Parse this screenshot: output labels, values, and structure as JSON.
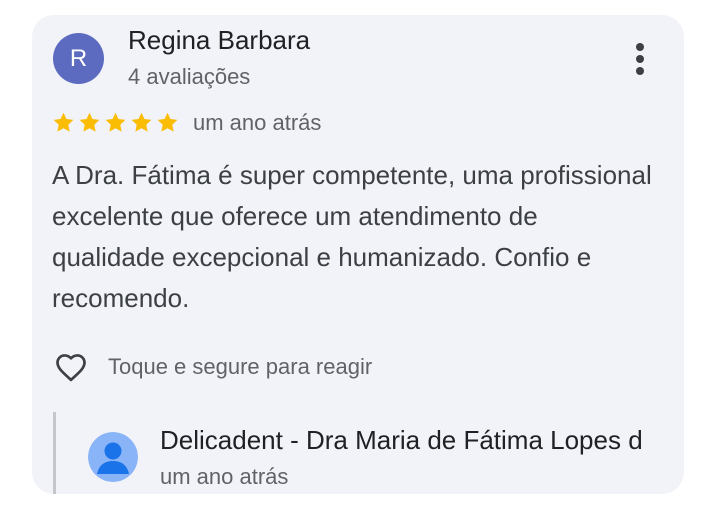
{
  "review": {
    "avatar_letter": "R",
    "reviewer_name": "Regina Barbara",
    "review_count": "4 avaliações",
    "rating": 5,
    "time": "um ano atrás",
    "text": "A Dra. Fátima é super competente, uma profissional excelente que oferece um atendimento de qualidade excepcional e humanizado. Confio e recomendo.",
    "react_hint": "Toque e segure para reagir",
    "more_icon": "more-vert-icon",
    "heart_icon": "heart-outline-icon"
  },
  "owner_reply": {
    "name": "Delicadent - Dra Maria de Fátima Lopes d",
    "time": "um ano atrás",
    "avatar_icon": "person-avatar-icon"
  },
  "colors": {
    "card_background": "#f2f3f8",
    "avatar": "#5c6bc0",
    "star": "#fbbc04",
    "owner_avatar_bg": "#8ab4f8",
    "owner_avatar_figure": "#1a73e8"
  }
}
